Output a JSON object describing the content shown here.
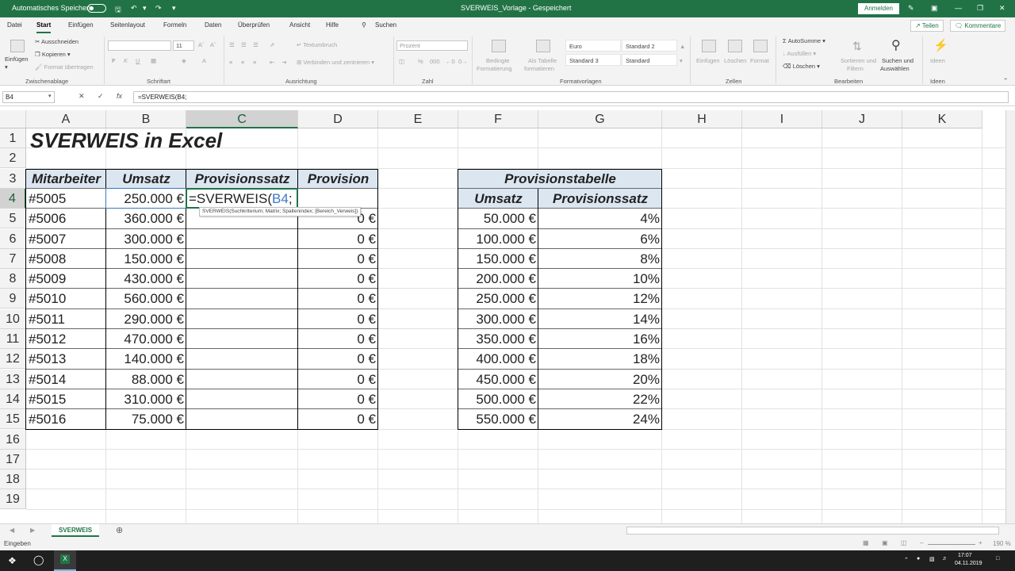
{
  "titlebar": {
    "autosave_label": "Automatisches Speichern",
    "doc_title": "SVERWEIS_Vorlage  -  Gespeichert",
    "signin_label": "Anmelden"
  },
  "tabs": [
    "Datei",
    "Start",
    "Einfügen",
    "Seitenlayout",
    "Formeln",
    "Daten",
    "Überprüfen",
    "Ansicht",
    "Hilfe"
  ],
  "search_label": "Suchen",
  "share_label": "Teilen",
  "comments_label": "Kommentare",
  "ribbon": {
    "clipboard": {
      "paste": "Einfügen",
      "cut": "Ausschneiden",
      "copy": "Kopieren",
      "format_painter": "Format übertragen",
      "group": "Zwischenablage"
    },
    "font": {
      "size": "11",
      "group": "Schriftart"
    },
    "alignment": {
      "wrap": "Textumbruch",
      "merge": "Verbinden und zentrieren",
      "group": "Ausrichtung"
    },
    "number": {
      "format": "Prozent",
      "group": "Zahl"
    },
    "styles": {
      "cond": "Bedingte",
      "cond2": "Formatierung",
      "table": "Als Tabelle",
      "table2": "formatieren",
      "euro": "Euro",
      "std2": "Standard 2",
      "std3": "Standard 3",
      "std": "Standard",
      "group": "Formatvorlagen"
    },
    "cells": {
      "insert": "Einfügen",
      "delete": "Löschen",
      "format": "Format",
      "group": "Zellen"
    },
    "editing": {
      "autosum": "AutoSumme",
      "fill": "Ausfüllen",
      "clear": "Löschen",
      "sort": "Sortieren und",
      "sort2": "Filtern",
      "find": "Suchen und",
      "find2": "Auswählen",
      "group": "Bearbeiten"
    },
    "ideas": {
      "label": "Ideen",
      "group": "Ideen"
    }
  },
  "formula_bar": {
    "name_box": "B4",
    "formula": "=SVERWEIS(B4;"
  },
  "columns": [
    "A",
    "B",
    "C",
    "D",
    "E",
    "F",
    "G",
    "H",
    "I",
    "J",
    "K"
  ],
  "rows": [
    "1",
    "2",
    "3",
    "4",
    "5",
    "6",
    "7",
    "8",
    "9",
    "10",
    "11",
    "12",
    "13",
    "14",
    "15",
    "16",
    "17",
    "18",
    "19"
  ],
  "sheet": {
    "title": "SVERWEIS in Excel",
    "headers": [
      "Mitarbeiter",
      "Umsatz",
      "Provisionssatz",
      "Provision"
    ],
    "employees": [
      {
        "id": "#5005",
        "sales": "250.000 €",
        "commission": ""
      },
      {
        "id": "#5006",
        "sales": "360.000 €",
        "commission": "0 €"
      },
      {
        "id": "#5007",
        "sales": "300.000 €",
        "commission": "0 €"
      },
      {
        "id": "#5008",
        "sales": "150.000 €",
        "commission": "0 €"
      },
      {
        "id": "#5009",
        "sales": "430.000 €",
        "commission": "0 €"
      },
      {
        "id": "#5010",
        "sales": "560.000 €",
        "commission": "0 €"
      },
      {
        "id": "#5011",
        "sales": "290.000 €",
        "commission": "0 €"
      },
      {
        "id": "#5012",
        "sales": "470.000 €",
        "commission": "0 €"
      },
      {
        "id": "#5013",
        "sales": "140.000 €",
        "commission": "0 €"
      },
      {
        "id": "#5014",
        "sales": "88.000 €",
        "commission": "0 €"
      },
      {
        "id": "#5015",
        "sales": "310.000 €",
        "commission": "0 €"
      },
      {
        "id": "#5016",
        "sales": "75.000 €",
        "commission": "0 €"
      }
    ],
    "edit_text_prefix": "=SVERWEIS(",
    "edit_text_ref": "B4",
    "edit_text_suffix": ";",
    "tooltip": "SVERWEIS(Suchkriterium; Matrix; Spaltenindex; [Bereich_Verweis])",
    "lookup_title": "Provisionstabelle",
    "lookup_headers": [
      "Umsatz",
      "Provisionssatz"
    ],
    "lookup": [
      {
        "sales": "50.000 €",
        "rate": "4%"
      },
      {
        "sales": "100.000 €",
        "rate": "6%"
      },
      {
        "sales": "150.000 €",
        "rate": "8%"
      },
      {
        "sales": "200.000 €",
        "rate": "10%"
      },
      {
        "sales": "250.000 €",
        "rate": "12%"
      },
      {
        "sales": "300.000 €",
        "rate": "14%"
      },
      {
        "sales": "350.000 €",
        "rate": "16%"
      },
      {
        "sales": "400.000 €",
        "rate": "18%"
      },
      {
        "sales": "450.000 €",
        "rate": "20%"
      },
      {
        "sales": "500.000 €",
        "rate": "22%"
      },
      {
        "sales": "550.000 €",
        "rate": "24%"
      }
    ]
  },
  "sheet_tab": "SVERWEIS",
  "status": {
    "mode": "Eingeben",
    "zoom": "190 %"
  },
  "taskbar": {
    "time": "17:07",
    "date": "04.11.2019"
  },
  "colors": {
    "accent": "#217346",
    "header_fill": "#dce6f1",
    "ref_blue": "#3c78c0"
  }
}
